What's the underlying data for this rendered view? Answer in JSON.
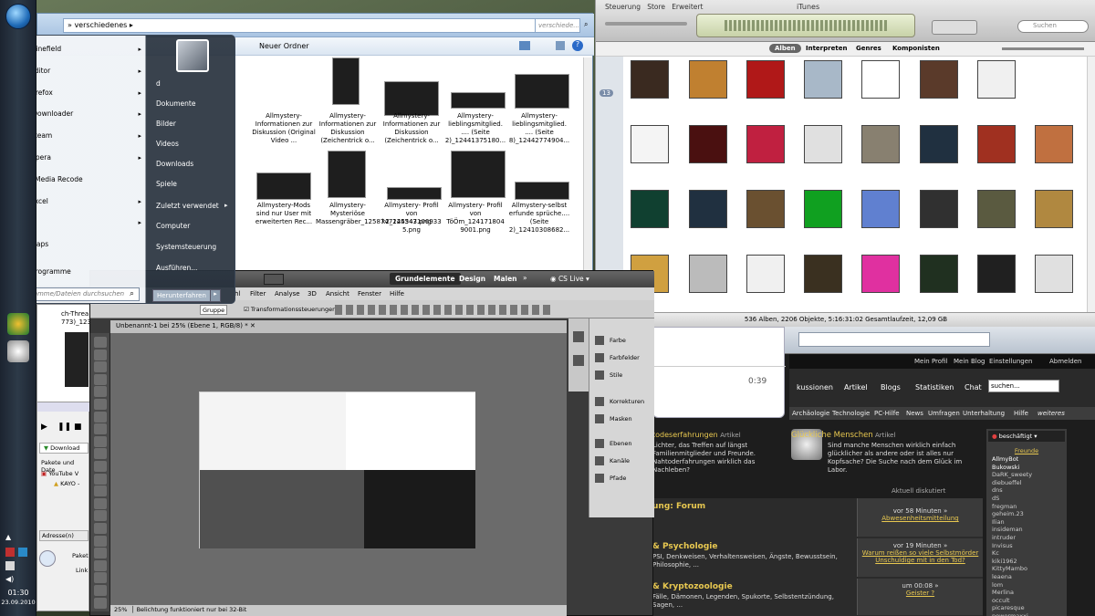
{
  "explorer": {
    "breadcrumb": "verschiedenes",
    "search_placeholder": "verschiede...",
    "new_folder": "Neuer Ordner",
    "files_row1": [
      {
        "name": "Allmystery-Informationen zur Diskussion (Original Video ..."
      },
      {
        "name": "Allmystery-Informationen zur Diskussion (Zeichentrick o..."
      },
      {
        "name": "Allmystery-Informationen zur Diskussion (Zeichentrick o..."
      },
      {
        "name": "Allmystery-lieblingsmitglied. .... (Seite 2)_12441375180..."
      },
      {
        "name": "Allmystery-lieblingsmitglied. .... (Seite 8)_12442774904..."
      }
    ],
    "files_row2": [
      {
        "name": "Allmystery-Mods sind nur User mit erweiterten Rec..."
      },
      {
        "name": "Allmystery-Mysteriöse Massengräber_1258747244543.png"
      },
      {
        "name": "Allmystery- Profil von k2_125347106933 5.png"
      },
      {
        "name": "Allmystery- Profil von TöÖm_124171804 9001.png"
      },
      {
        "name": "Allmystery-selbst erfunde sprüche.... (Seite 2)_12410308682..."
      }
    ]
  },
  "start_menu": {
    "programs": [
      {
        "label": "Minefield",
        "arrow": true,
        "color": "#2a5fb0"
      },
      {
        "label": "Editor",
        "arrow": true,
        "color": "#5a8fc8"
      },
      {
        "label": "Firefox",
        "arrow": true,
        "color": "#e86a10"
      },
      {
        "label": "JDownloader",
        "arrow": true,
        "color": "#f0b020"
      },
      {
        "label": "Steam",
        "arrow": true,
        "color": "#333333"
      },
      {
        "label": "Opera",
        "arrow": true,
        "color": "#cc1010"
      },
      {
        "label": "XMedia Recode",
        "arrow": false,
        "color": "#888888"
      },
      {
        "label": "Excel",
        "arrow": true,
        "color": "#1e7a35"
      },
      {
        "label": "IE",
        "arrow": true,
        "color": "#2a8ad8"
      },
      {
        "label": "Fraps",
        "arrow": false,
        "color": "#d8c020"
      }
    ],
    "all_programs": "Alle Programme",
    "search_placeholder": "Programme/Dateien durchsuchen",
    "right_items": [
      "d",
      "Dokumente",
      "Bilder",
      "Videos",
      "Downloads",
      "Spiele",
      "Zuletzt verwendet",
      "Computer",
      "Systemsteuerung",
      "Ausführen..."
    ],
    "shutdown": "Herunterfahren"
  },
  "itunes": {
    "menu": [
      "Steuerung",
      "Store",
      "Erweitert"
    ],
    "title": "iTunes",
    "search_placeholder": "Suchen",
    "tabs": [
      "Alben",
      "Interpreten",
      "Genres",
      "Komponisten"
    ],
    "badge": "13",
    "status": "536 Alben, 2206 Objekte, 5:16:31:02 Gesamtlaufzeit, 12,09 GB",
    "album_colors": [
      [
        "#3a2a20",
        "#c08030",
        "#b01818",
        "#a8b8c8",
        "#ffffff",
        "#5a3a2a",
        "#f0f0f0"
      ],
      [
        "#f4f4f4",
        "#4a1010",
        "#c02040",
        "#e0e0e0",
        "#888070",
        "#203040",
        "#a03020",
        "#c07040"
      ],
      [
        "#104030",
        "#203040",
        "#6a5030",
        "#10a020",
        "#6080d0",
        "#303030",
        "#5a5a40",
        "#b08840"
      ],
      [
        "#d0a040",
        "#bbbbbb",
        "#f0f0f0",
        "#3a3020",
        "#e030a0",
        "#203020",
        "#202020",
        "#e0e0e0"
      ]
    ]
  },
  "photoshop": {
    "workspaces": [
      "Grundelemente",
      "Design",
      "Malen"
    ],
    "cs_live": "CS Live",
    "menu": [
      "hl",
      "Filter",
      "Analyse",
      "3D",
      "Ansicht",
      "Fenster",
      "Hilfe"
    ],
    "transform_label": "Transformationssteuerungen",
    "group_label": "Gruppe",
    "doc_tab": "Unbenannt-1 bei 25% (Ebene 1, RGB/8) *",
    "panels": [
      "Farbe",
      "Farbfelder",
      "Stile",
      "Korrekturen",
      "Masken",
      "Ebenen",
      "Kanäle",
      "Pfade"
    ],
    "zoom": "25%",
    "status": "Belichtung funktioniert nur bei 32-Bit"
  },
  "browser": {
    "links": [
      "Mein Profil",
      "Mein Blog",
      "Einstellungen",
      "Abmelden"
    ],
    "nav": [
      "kussionen",
      "Artikel",
      "Blogs",
      "Statistiken",
      "Chat"
    ],
    "search_value": "suchen...",
    "subnav": [
      "Archäologie",
      "Technologie",
      "PC-Hilfe",
      "News",
      "Umfragen",
      "Unterhaltung",
      "Hilfe",
      "weiteres"
    ],
    "article_title": "Glückliche Menschen",
    "article_tag": "Artikel",
    "article_text": "Sind manche Menschen wirklich einfach glücklicher als andere oder ist alles nur Kopfsache? Die Suche nach dem Glück im Labor.",
    "left_title": "todeserfahrungen",
    "left_tag": "Artikel",
    "left_text": "Lichter, das Treffen auf längst Familienmitglieder und Freunde. Nahtoderfahrungen wirklich das Nachleben?",
    "discussed": "Aktuell diskutiert",
    "forum_title": "ung: Forum",
    "forum_time1": "vor 58 Minuten »",
    "forum_link1": "Abwesenheitsmitteilung",
    "section2": "& Psychologie",
    "section2_text": "PSI, Denkweisen, Verhaltensweisen, Ängste, Bewusstsein, Philosophie, ...",
    "time2": "vor 19 Minuten »",
    "link2": "Warum reißen so viele Selbstmörder Unschuldige mit in den Tod?",
    "section3": "& Kryptozoologie",
    "section3_text": "Fälle, Dämonen, Legenden, Spukorte, Selbstentzündung, Sagen, ...",
    "time3": "um 00:08 »",
    "link3": "Geister ?",
    "status": "beschäftigt",
    "friends_label": "Freunde",
    "friends": [
      "AllmyBot",
      "Bukowski",
      "DaRK_sweety",
      "diebueffel",
      "dns",
      "dS",
      "fregman",
      "geheim.23",
      "Ilian",
      "insideman",
      "intruder",
      "Invisus",
      "Kc",
      "kiki1962",
      "KittyMambo",
      "leaena",
      "lom",
      "Merlina",
      "occult",
      "picaresque",
      "powermaxxi"
    ],
    "chat_time": "0:39"
  },
  "taskbar": {
    "time": "01:30",
    "date": "23.09.2010"
  },
  "left_windows": {
    "ch_thread": "ch-Threa 773)_123",
    "download": "Download",
    "packages": "Pakete und Date",
    "youtube": "YouTube V",
    "kayo": "KAYO -",
    "address": "Adresse(n)",
    "paket": "Paket",
    "link": "Link"
  }
}
